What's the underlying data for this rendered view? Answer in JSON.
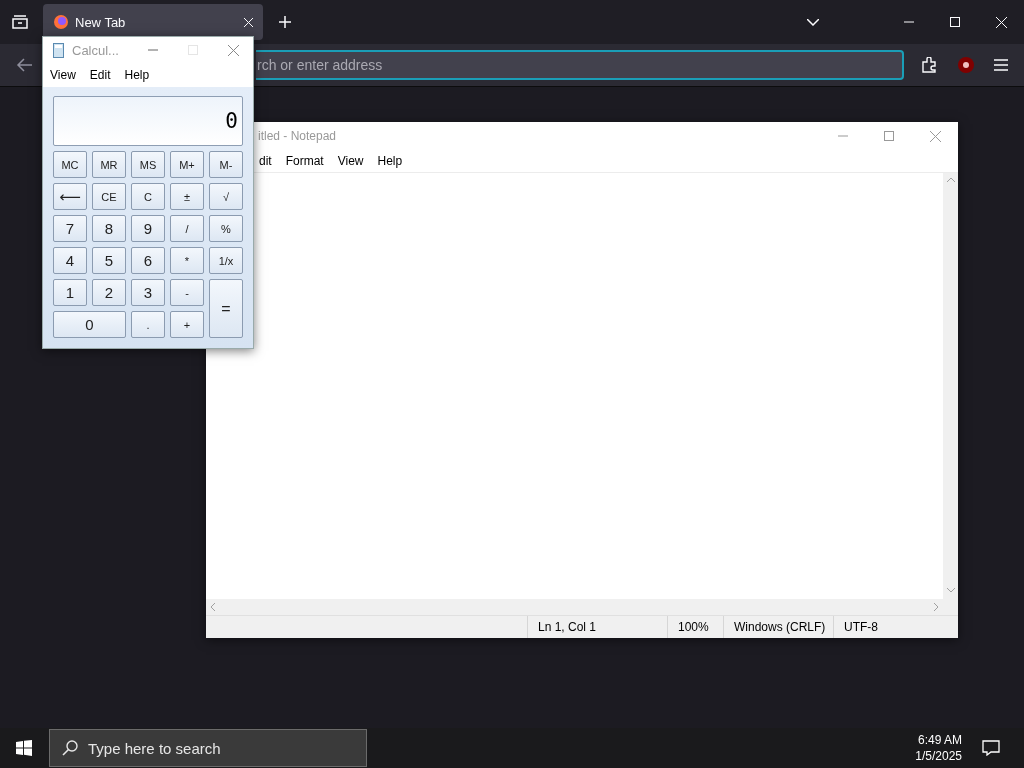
{
  "browser": {
    "tabs": [
      {
        "label": "New Tab",
        "selected": true
      }
    ],
    "address": {
      "placeholder": "rch or enter address",
      "focused": true
    }
  },
  "notepad": {
    "title": "itled - Notepad",
    "menu": [
      "dit",
      "Format",
      "View",
      "Help"
    ],
    "status": [
      "Ln 1, Col 1",
      "100%",
      "Windows (CRLF)",
      "UTF-8"
    ]
  },
  "calculator": {
    "title": "Calcul...",
    "menu": [
      "View",
      "Edit",
      "Help"
    ],
    "display": "0",
    "keys": [
      {
        "label": "MC",
        "kind": "small"
      },
      {
        "label": "MR",
        "kind": "small"
      },
      {
        "label": "MS",
        "kind": "small"
      },
      {
        "label": "M+",
        "kind": "small"
      },
      {
        "label": "M-",
        "kind": "small"
      },
      {
        "label": "⟵",
        "kind": "normal"
      },
      {
        "label": "CE",
        "kind": "small"
      },
      {
        "label": "C",
        "kind": "small"
      },
      {
        "label": "±",
        "kind": "small"
      },
      {
        "label": "√",
        "kind": "small"
      },
      {
        "label": "7",
        "kind": "normal"
      },
      {
        "label": "8",
        "kind": "normal"
      },
      {
        "label": "9",
        "kind": "normal"
      },
      {
        "label": "/",
        "kind": "small"
      },
      {
        "label": "%",
        "kind": "small"
      },
      {
        "label": "4",
        "kind": "normal"
      },
      {
        "label": "5",
        "kind": "normal"
      },
      {
        "label": "6",
        "kind": "normal"
      },
      {
        "label": "*",
        "kind": "small"
      },
      {
        "label": "1/x",
        "kind": "small"
      },
      {
        "label": "1",
        "kind": "normal"
      },
      {
        "label": "2",
        "kind": "normal"
      },
      {
        "label": "3",
        "kind": "normal"
      },
      {
        "label": "-",
        "kind": "small"
      },
      {
        "label": "=",
        "kind": "tall"
      },
      {
        "label": "0",
        "kind": "wide"
      },
      {
        "label": ".",
        "kind": "small"
      },
      {
        "label": "+",
        "kind": "small"
      }
    ]
  },
  "taskbar": {
    "search": {
      "placeholder": "Type here to search"
    },
    "time": "6:49 AM",
    "date": "1/5/2025"
  }
}
